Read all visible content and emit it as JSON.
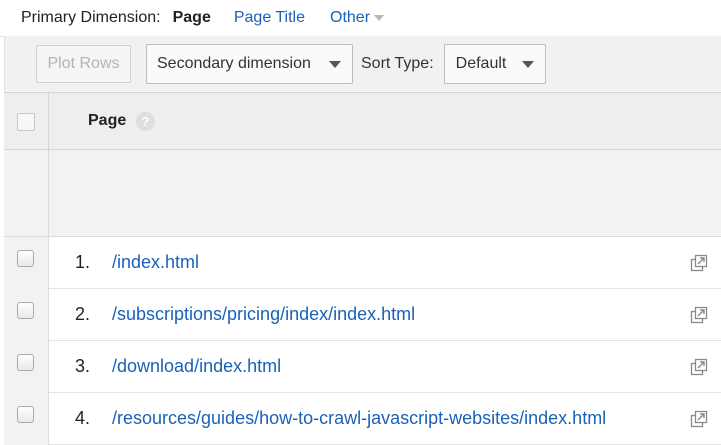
{
  "primary_dimension": {
    "label": "Primary Dimension:",
    "active": "Page",
    "options": [
      "Page Title",
      "Other"
    ]
  },
  "toolbar": {
    "plot_rows": "Plot Rows",
    "secondary_dimension": "Secondary dimension",
    "sort_type_label": "Sort Type:",
    "sort_type_value": "Default"
  },
  "table": {
    "column_header": "Page",
    "help_glyph": "?",
    "rows": [
      {
        "index": "1.",
        "page": "/index.html"
      },
      {
        "index": "2.",
        "page": "/subscriptions/pricing/index/index.html"
      },
      {
        "index": "3.",
        "page": "/download/index.html"
      },
      {
        "index": "4.",
        "page": "/resources/guides/how-to-crawl-javascript-websites/index.html"
      }
    ]
  },
  "icons": {
    "dropdown": "chevron-down-icon",
    "help": "help-icon",
    "open_external": "open-in-new-window-icon"
  },
  "colors": {
    "link": "#1a62b8",
    "toolbar_bg": "#f1f1f1",
    "header_bg": "#eeeeee"
  }
}
